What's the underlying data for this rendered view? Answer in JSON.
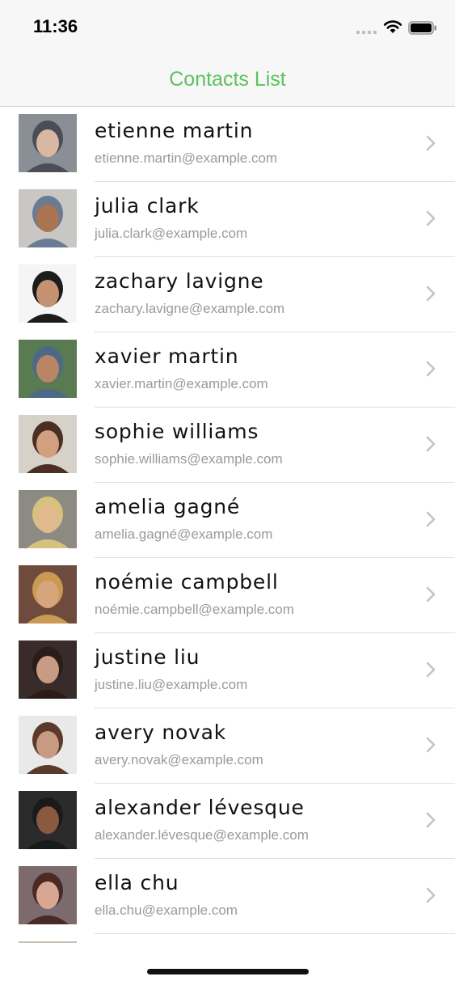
{
  "status_bar": {
    "time": "11:36",
    "icons": [
      "signal-icon",
      "wifi-icon",
      "battery-icon"
    ]
  },
  "nav": {
    "title": "Contacts List",
    "title_color": "#5cc15f"
  },
  "contacts": [
    {
      "name": "etienne martin",
      "email": "etienne.martin@example.com",
      "avatar_colors": [
        "#8a8f95",
        "#d9b8a3",
        "#4a4f57"
      ]
    },
    {
      "name": "julia clark",
      "email": "julia.clark@example.com",
      "avatar_colors": [
        "#c9c7c4",
        "#a9744f",
        "#6a7c93"
      ]
    },
    {
      "name": "zachary lavigne",
      "email": "zachary.lavigne@example.com",
      "avatar_colors": [
        "#f5f5f5",
        "#c49270",
        "#1c1c1c"
      ]
    },
    {
      "name": "xavier martin",
      "email": "xavier.martin@example.com",
      "avatar_colors": [
        "#5a7a52",
        "#b98565",
        "#4c6a86"
      ]
    },
    {
      "name": "sophie williams",
      "email": "sophie.williams@example.com",
      "avatar_colors": [
        "#d7d2c9",
        "#d2a081",
        "#4a2f22"
      ]
    },
    {
      "name": "amelia gagné",
      "email": "amelia.gagné@example.com",
      "avatar_colors": [
        "#8c8a83",
        "#e0b98e",
        "#d7c27d"
      ]
    },
    {
      "name": "noémie campbell",
      "email": "noémie.campbell@example.com",
      "avatar_colors": [
        "#6e4b3c",
        "#d6a57c",
        "#c99a54"
      ]
    },
    {
      "name": "justine liu",
      "email": "justine.liu@example.com",
      "avatar_colors": [
        "#3a2b2b",
        "#c89b84",
        "#2a1c18"
      ]
    },
    {
      "name": "avery novak",
      "email": "avery.novak@example.com",
      "avatar_colors": [
        "#e9e9e9",
        "#c79a81",
        "#5b3a2a"
      ]
    },
    {
      "name": "alexander lévesque",
      "email": "alexander.lévesque@example.com",
      "avatar_colors": [
        "#2b2b2b",
        "#8a5a40",
        "#1a1a1a"
      ]
    },
    {
      "name": "ella chu",
      "email": "ella.chu@example.com",
      "avatar_colors": [
        "#7d6a6e",
        "#d8a794",
        "#4a2a24"
      ]
    },
    {
      "name": "",
      "email": "",
      "avatar_colors": [
        "#cbbfb4",
        "#b89a86",
        "#8a7060"
      ]
    }
  ]
}
